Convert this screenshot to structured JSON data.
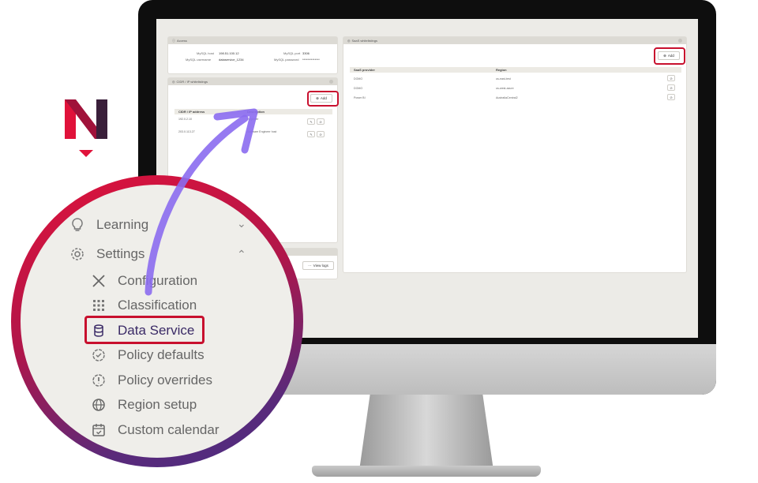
{
  "access": {
    "header": "Access",
    "mysql_host_label": "MySQL host",
    "mysql_host_value": "198.51.100.12",
    "mysql_port_label": "MySQL port",
    "mysql_port_value": "3306",
    "mysql_username_label": "MySQL username",
    "mysql_username_value": "dataservice_1234",
    "mysql_password_label": "MySQL password",
    "mysql_password_value": "**************"
  },
  "cidr": {
    "header": "CIDR / IP whitelistings",
    "add_label": "Add",
    "columns": [
      "CIDR / IP address",
      "Description"
    ],
    "rows": [
      {
        "cidr": "192.0.2.10",
        "description": "Engineer"
      },
      {
        "cidr": "203.0.113.27",
        "description": "Software Engineer host"
      }
    ]
  },
  "logs": {
    "view_logs_label": "View logs"
  },
  "saas": {
    "header": "SaaS whitelistings",
    "add_label": "Add",
    "columns": [
      "SaaS provider",
      "Region"
    ],
    "rows": [
      {
        "provider": "DOMO",
        "region": "us-east-test"
      },
      {
        "provider": "DOMO",
        "region": "us-west-azure"
      },
      {
        "provider": "Power BI",
        "region": "AustraliaCentral2"
      }
    ]
  },
  "nav": {
    "items": [
      {
        "label": "Learning",
        "icon": "lightbulb-icon"
      },
      {
        "label": "Settings",
        "icon": "gear-icon"
      }
    ],
    "sub_items": [
      {
        "label": "Configuration",
        "icon": "tools-icon"
      },
      {
        "label": "Classification",
        "icon": "grid-icon"
      },
      {
        "label": "Data Service",
        "icon": "database-icon"
      },
      {
        "label": "Policy defaults",
        "icon": "badge-check-icon"
      },
      {
        "label": "Policy overrides",
        "icon": "exclamation-badge-icon"
      },
      {
        "label": "Region setup",
        "icon": "globe-icon"
      },
      {
        "label": "Custom calendar",
        "icon": "calendar-icon"
      }
    ]
  },
  "colors": {
    "highlight": "#c8102e",
    "arrow": "#8b6cf0",
    "brand_red": "#e0123a",
    "brand_dark": "#3a2a66",
    "ring_start": "#e0123a",
    "ring_end": "#4a2c82"
  }
}
